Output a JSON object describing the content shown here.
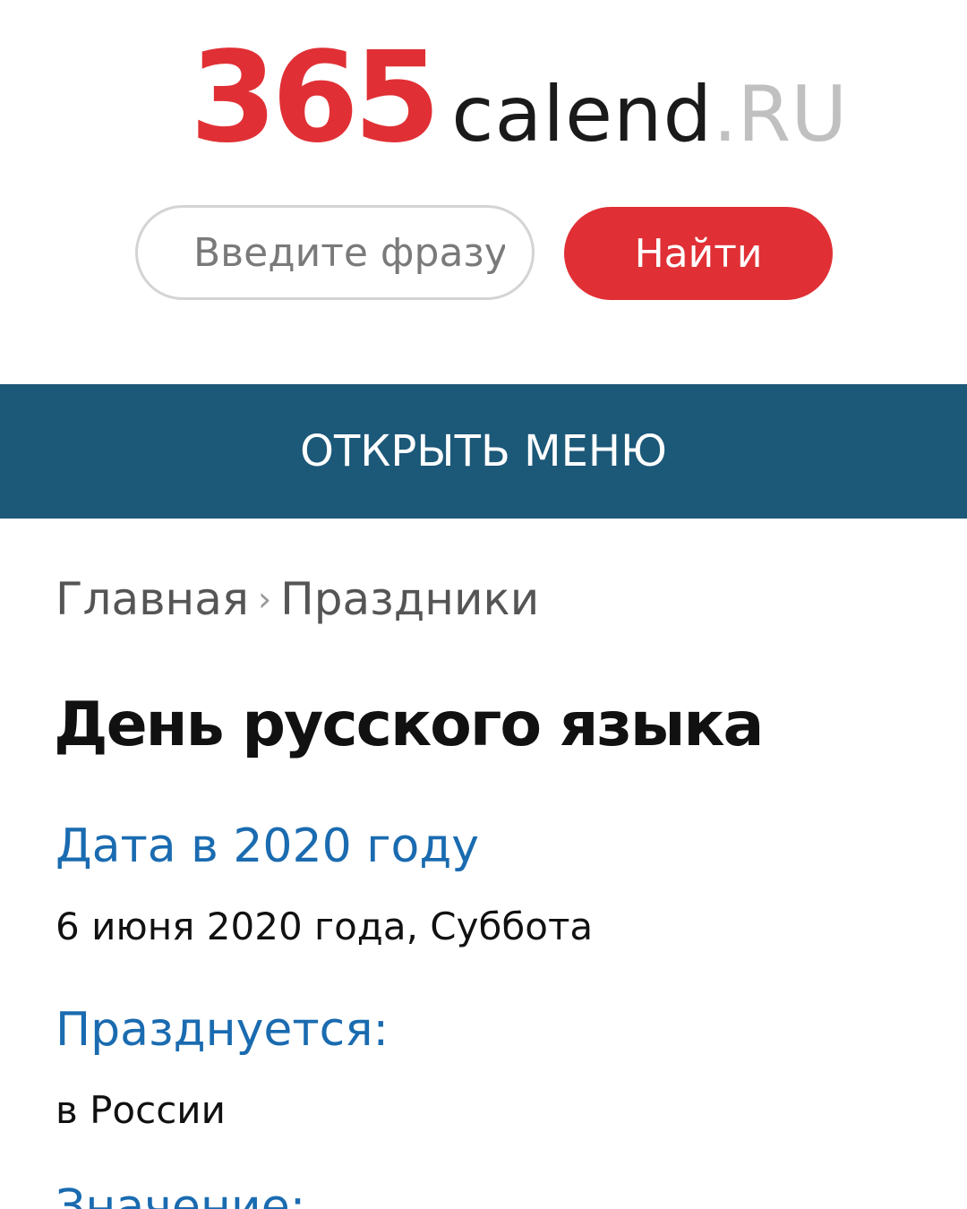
{
  "colors": {
    "accent_red": "#e03035",
    "menu_bar": "#1c5878",
    "link_blue": "#1a6bb0",
    "logo_dark": "#1a1a1a",
    "logo_tld": "#c0c0c0"
  },
  "logo": {
    "number": "365",
    "name": "calend",
    "tld": ".RU"
  },
  "search": {
    "placeholder": "Введите фразу",
    "button_label": "Найти"
  },
  "menu": {
    "toggle_label": "ОТКРЫТЬ МЕНЮ"
  },
  "breadcrumb": {
    "items": [
      "Главная",
      "Праздники"
    ],
    "separator": "›"
  },
  "main": {
    "title": "День русского языка",
    "sections": [
      {
        "heading": "Дата в 2020 году",
        "text": "6 июня 2020 года, Суббота"
      },
      {
        "heading": "Празднуется:",
        "text": "в России"
      },
      {
        "heading": "Значение:",
        "text": ""
      }
    ]
  }
}
